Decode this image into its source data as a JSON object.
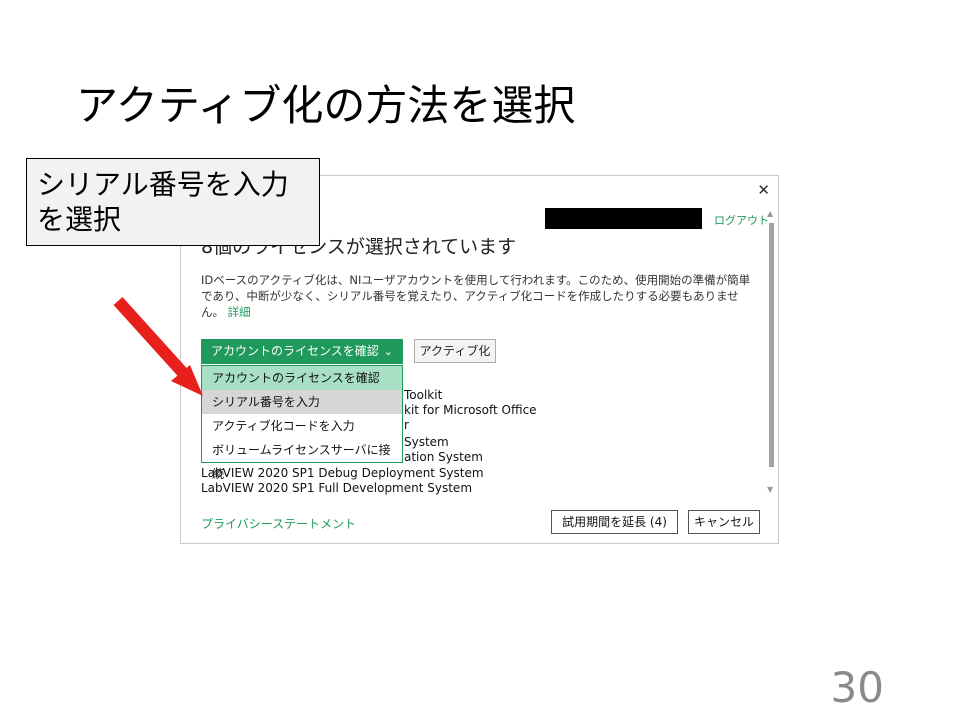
{
  "slide": {
    "title": "アクティブ化の方法を選択",
    "page_number": "30",
    "callout": [
      "シリアル番号を入力",
      "を選択"
    ]
  },
  "dialog": {
    "close_icon": "close-icon",
    "logout": "ログアウト",
    "selected_count": "8個のライセンスが選択されています",
    "info_text": "IDベースのアクティブ化は、NIユーザアカウントを使用して行われます。このため、使用開始の準備が簡単であり、中断が少なく、シリアル番号を覚えたり、アクティブ化コードを作成したりする必要もありません。",
    "info_link": "詳細",
    "method_select": {
      "value": "アカウントのライセンスを確認",
      "options": [
        "アカウントのライセンスを確認",
        "シリアル番号を入力",
        "アクティブ化コードを入力",
        "ボリュームライセンスサーバに接続"
      ]
    },
    "activate_button": "アクティブ化",
    "products_visible": [
      "Toolkit",
      "kit for Microsoft Office",
      "r",
      "System",
      "ation System",
      "LabVIEW 2020 SP1 Debug Deployment System",
      "LabVIEW 2020 SP1 Full Development System"
    ],
    "privacy_link": "プライバシーステートメント",
    "extend_button": "試用期間を延長 (4)",
    "cancel_button": "キャンセル"
  },
  "colors": {
    "accent": "#1f9a5c",
    "option_selected": "#a8e0c6",
    "option_hover": "#d6d6d6",
    "arrow": "#e8201c"
  }
}
